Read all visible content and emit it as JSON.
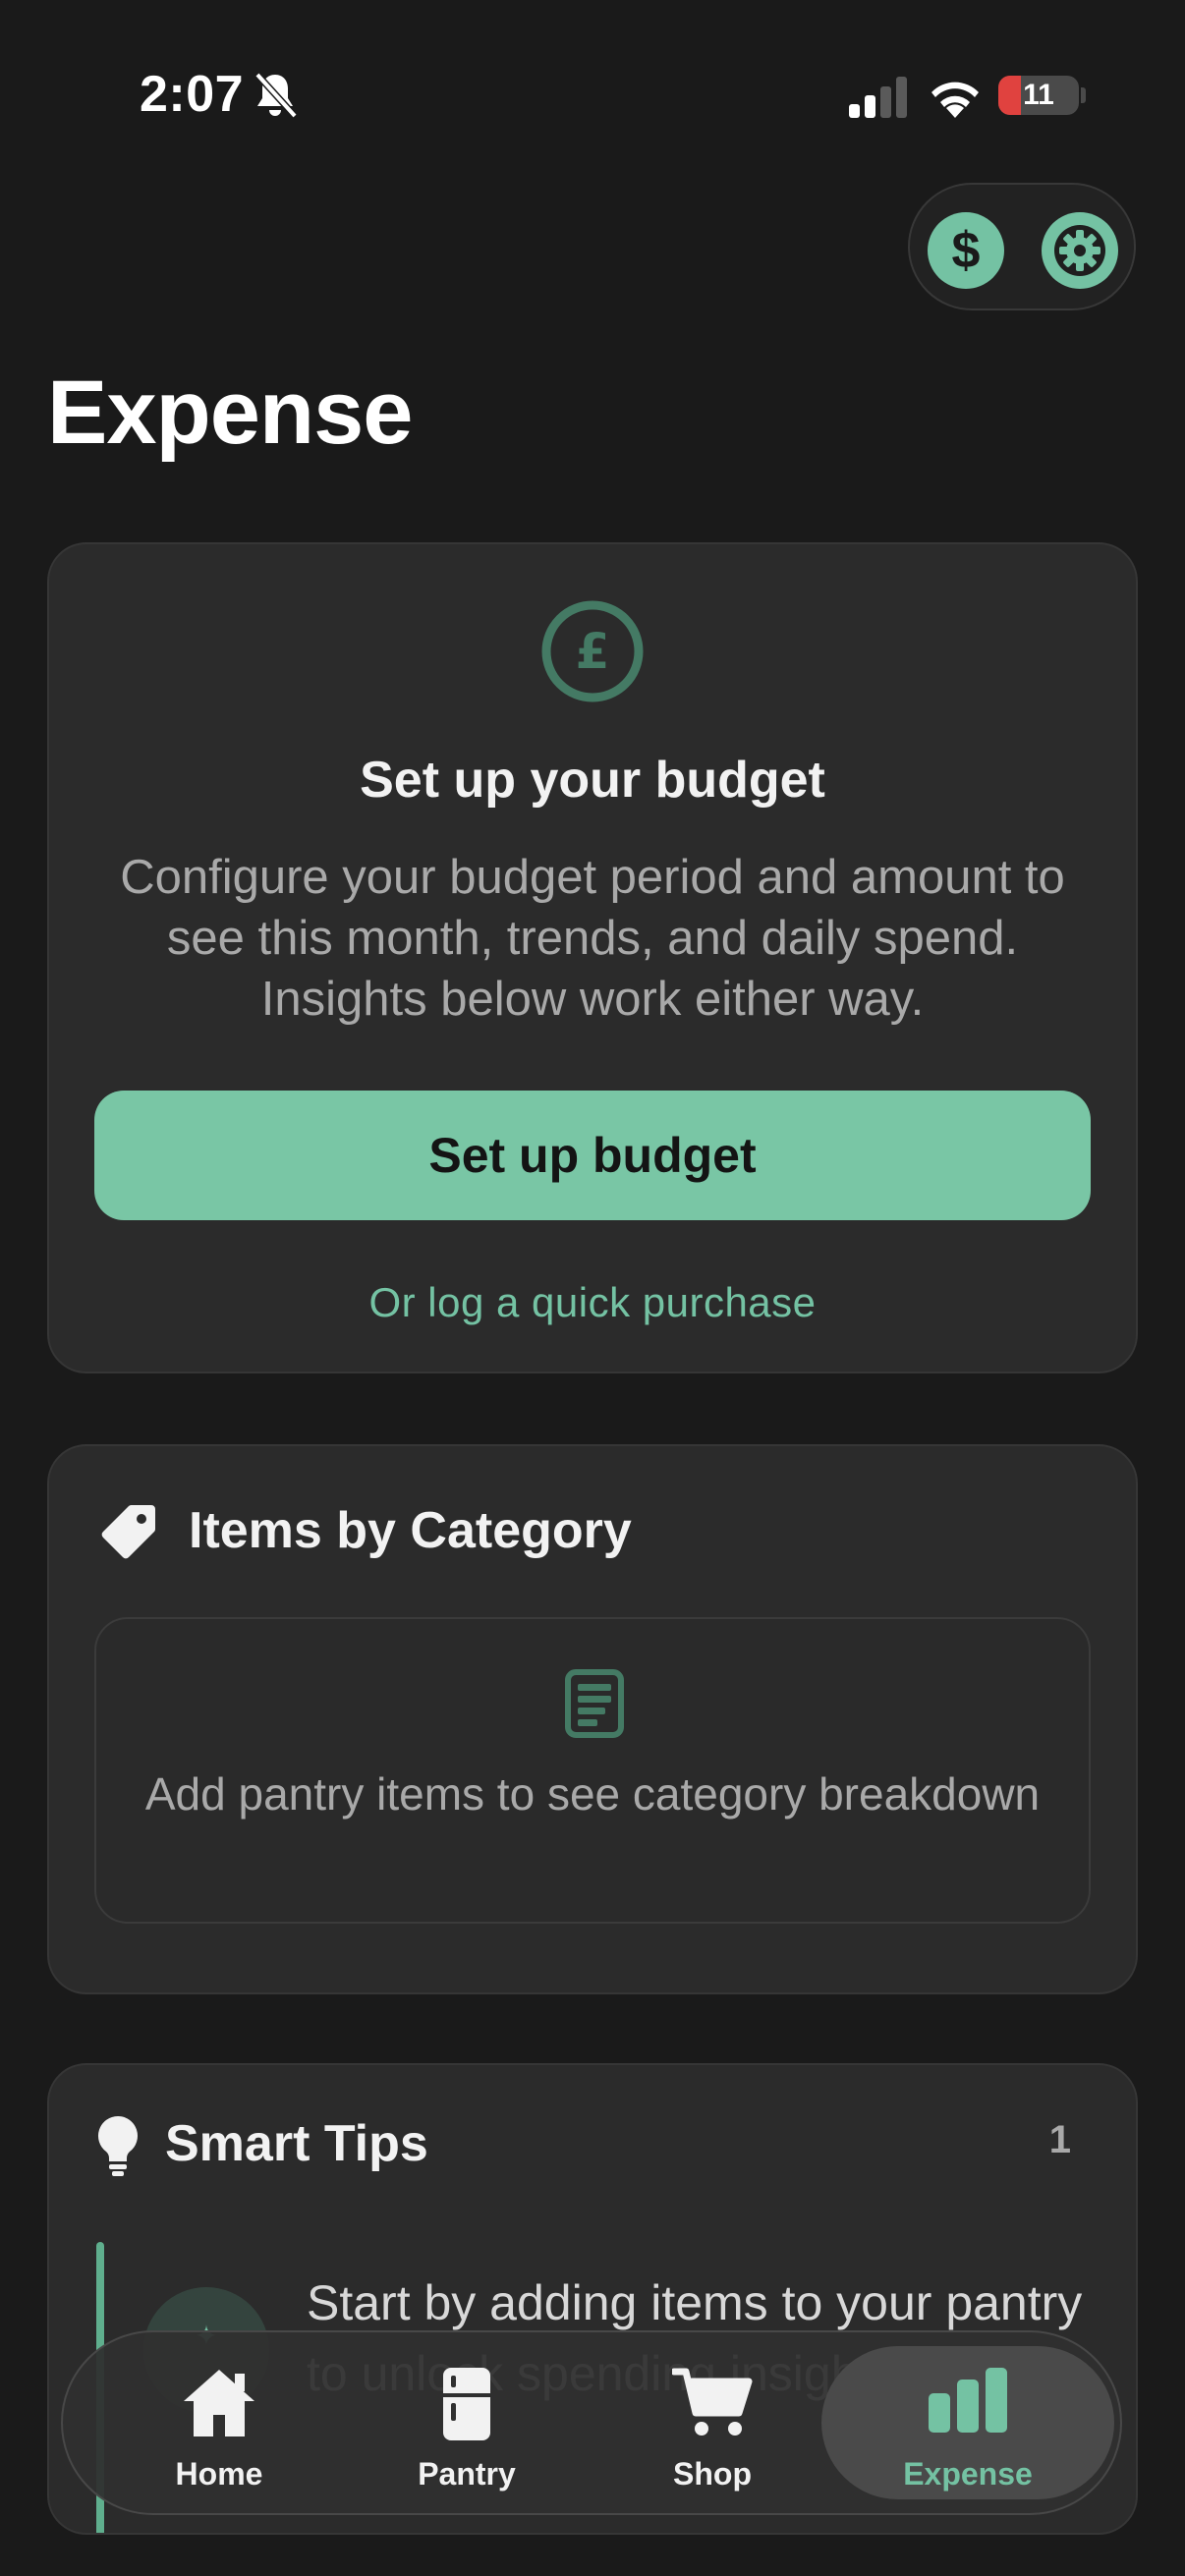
{
  "status_bar": {
    "time": "2:07",
    "battery_level": "11",
    "battery_fraction": 0.11,
    "icons": [
      "bell-slash-icon",
      "cellular-signal-icon",
      "wifi-icon",
      "battery-icon"
    ]
  },
  "top_actions": {
    "currency_symbol": "$",
    "icons": [
      "dollar-icon",
      "gear-icon"
    ]
  },
  "page": {
    "title": "Expense"
  },
  "budget_card": {
    "icon": "pound-icon",
    "heading": "Set up your budget",
    "description": "Configure your budget period and amount to see this month, trends, and daily spend. Insights below work either way.",
    "button_label": "Set up budget",
    "link_label": "Or log a quick purchase"
  },
  "category_card": {
    "icon": "tag-icon",
    "title": "Items by Category",
    "empty_icon": "document-icon",
    "empty_text": "Add pantry items to see category breakdown"
  },
  "tips_card": {
    "icon": "lightbulb-icon",
    "title": "Smart Tips",
    "count": "1",
    "tip_text": "Start by adding items to your pantry to unlock spending insights"
  },
  "tab_bar": {
    "tabs": [
      {
        "label": "Home",
        "icon": "home-icon"
      },
      {
        "label": "Pantry",
        "icon": "fridge-icon"
      },
      {
        "label": "Shop",
        "icon": "cart-icon"
      },
      {
        "label": "Expense",
        "icon": "bar-chart-icon",
        "active": true
      }
    ]
  },
  "colors": {
    "background": "#1a1a1a",
    "card": "#2b2b2b",
    "accent": "#74c2a3",
    "battery_low": "#e0423f"
  }
}
